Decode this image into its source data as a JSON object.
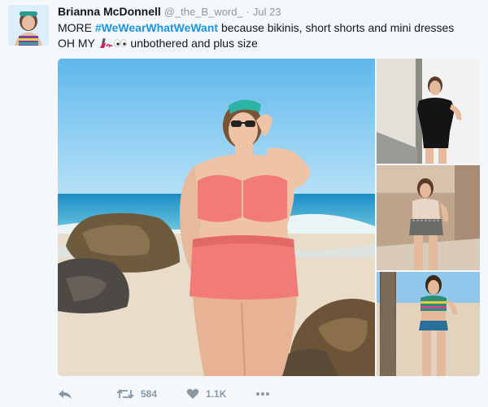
{
  "tweet": {
    "name": "Brianna McDonnell",
    "handle": "@_the_B_word_",
    "separator": "·",
    "date": "Jul 23",
    "text_part1": "MORE ",
    "hashtag": "#WeWearWhatWeWant",
    "text_part2": " because bikinis, short shorts and mini dresses",
    "text_part3": "OH MY ",
    "text_part4": " unbothered and plus size"
  },
  "actions": {
    "retweet_count": "584",
    "like_count": "1.1K"
  },
  "icons": [
    "reply-icon",
    "retweet-icon",
    "heart-icon",
    "more-icon",
    "nail-polish-emoji",
    "eyes-emoji"
  ],
  "colors": {
    "hashtag": "#1b95e0",
    "meta": "#8899a6",
    "background": "#f5f8fa"
  }
}
